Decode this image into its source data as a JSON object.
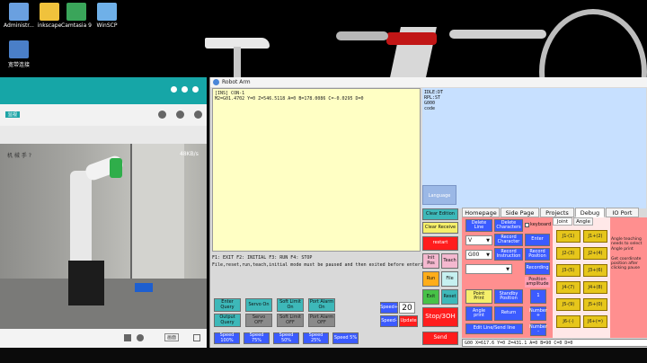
{
  "desktop": {
    "icons": [
      {
        "label": "Administr...",
        "icon": "folder-icon",
        "color": "#6aa0e0"
      },
      {
        "label": "inkscape",
        "icon": "folder-icon",
        "color": "#f0c23c"
      },
      {
        "label": "Camtasia 9",
        "icon": "camtasia-icon",
        "color": "#3aa55a"
      },
      {
        "label": "WinSCP",
        "icon": "winscp-icon",
        "color": "#6fb0e8"
      },
      {
        "label": "宽带连接",
        "icon": "network-icon",
        "color": "#4a7fc8"
      }
    ]
  },
  "player": {
    "tag_label": "监视",
    "speed_label": "48KB/s",
    "overlay_text": "机 械 手 ?",
    "footer_button": "画面"
  },
  "robot_window": {
    "title": "Robot Arm",
    "console_lines": [
      "[INS] CON-1",
      "M2=G01.4702 Y=0 Z=546.5118 A=0 B=178.0086 C=-0.0295 D=0"
    ],
    "status_lines": [
      "IDLE:DT",
      "RPL:ST",
      "G000",
      "code"
    ],
    "language_button": "Language",
    "hint_line_1": "F1: EXIT  F2: INITIAL          F3: RUN F4: STOP",
    "hint_line_2": "File,reset,run,teach,initial mode must be paused and then exited before entering",
    "left_buttons": [
      {
        "label": "Enter\nQuery",
        "style": "teal"
      },
      {
        "label": "Servo On",
        "style": "teal"
      },
      {
        "label": "Soft Limit\nOn",
        "style": "teal"
      },
      {
        "label": "Port Alarm\nOn",
        "style": "teal"
      },
      {
        "label": "Output\nQuery",
        "style": "teal"
      },
      {
        "label": "Servo\nOFF",
        "style": "grey"
      },
      {
        "label": "Soft Limit\nOFF",
        "style": "grey"
      },
      {
        "label": "Port Alarm\nOFF",
        "style": "grey"
      }
    ],
    "speed_buttons": [
      "Speed 100%",
      "Speed 75%",
      "Speed 50%",
      "Speed 25%",
      "Speed 5%"
    ],
    "speed_plus": "Speed+",
    "speed_minus": "Speed-",
    "speed_value": "20",
    "update": "Update",
    "right_column": {
      "clear_edition": "Clear Edition",
      "clear_receive": "Clear Receive",
      "restart": "restart",
      "init_pos": "Init\nPos",
      "teach": "Teach",
      "run": "Run",
      "file": "File",
      "exit": "Exit",
      "reset": "Reset",
      "stop": "Stop/3OH",
      "send": "Send"
    },
    "tabs": [
      "Homepage",
      "Side Page",
      "Projects",
      "Debug",
      "IO Port"
    ],
    "active_tab": "Debug",
    "debug": {
      "delete_line": "Delete\nLine",
      "delete_chars": "Delete\nCharacters",
      "keyboard": "keyboard",
      "axis_select": "V",
      "record_char": "Record\nCharacter",
      "enter": "Enter",
      "gcode_select": "G00",
      "record_instr": "Record\nInstruction",
      "record_position": "Record\nPosition",
      "recording": "Recording",
      "position_amplitude": "Position\namplitude",
      "point_print": "Point\nPrint",
      "standby_position": "Standby\nPosition",
      "one": "1",
      "angle_print": "Angle\nprint",
      "return": "Return",
      "number_plus": "Number\n+",
      "edit_line": "Edit Line/Send line",
      "number_minus": "Number\n-"
    },
    "joint_tabs": [
      "Joint",
      "Angle"
    ],
    "joint_buttons": [
      "J1-(1)",
      "J1+(2)",
      "J2-(3)",
      "J2+(4)",
      "J3-(5)",
      "J3+(6)",
      "J4-(7)",
      "J4+(8)",
      "J5-(9)",
      "J5+(0)",
      "J6-(-)",
      "J6+(=)"
    ],
    "help_text": "Angle teaching needs to select Angle print\n\nGet coordinate position after clicking pause",
    "command_line": "G00 X=617.6 Y=0 Z=431.1 A=0 B=90 C=0 D=0"
  }
}
